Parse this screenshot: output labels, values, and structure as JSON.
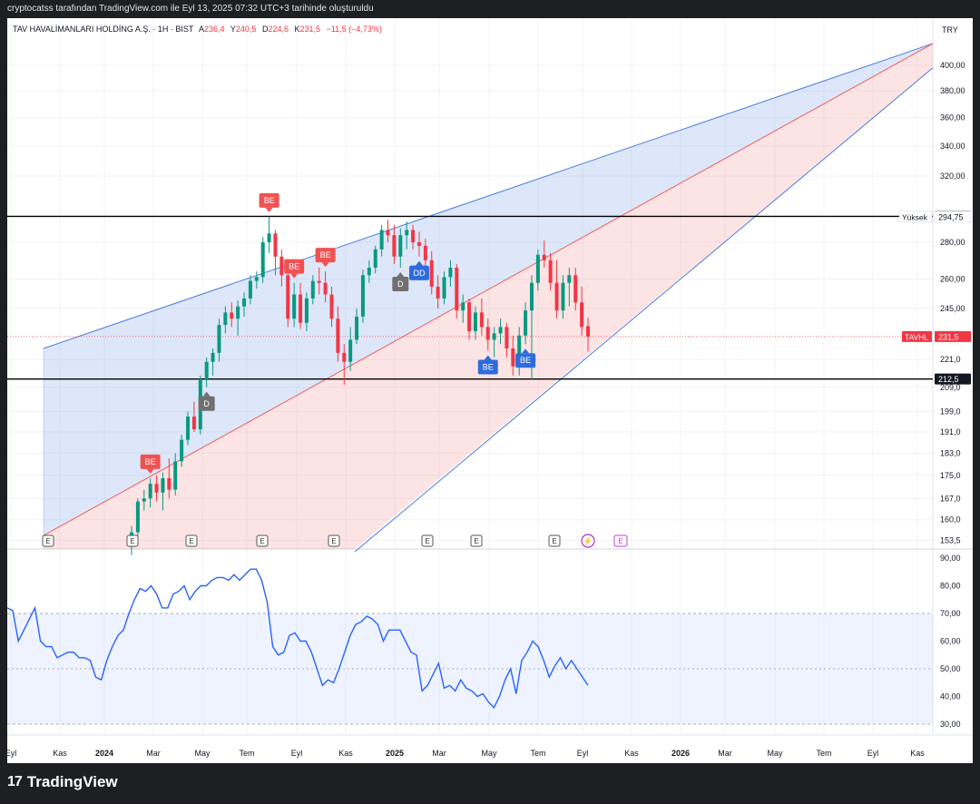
{
  "caption": "cryptocatss tarafından TradingView.com ile Eyl 13, 2025 07:32 UTC+3 tarihinde oluşturuldu",
  "brand": {
    "logo": "17",
    "name": "TradingView"
  },
  "header": {
    "symbol": "TAV HAVALİMANLARI HOLDİNG A.Ş. · 1H · BIST",
    "o_label": "A",
    "o_value": "236,4",
    "h_label": "Y",
    "h_value": "240,5",
    "l_label": "D",
    "l_value": "224,6",
    "c_label": "K",
    "c_value": "231,5",
    "change": "−11,5 (−4,73%)"
  },
  "currency": "TRY",
  "colors": {
    "up": "#089981",
    "down": "#f23645",
    "channel_blue": "#4a7bdc",
    "channel_red": "#f05a5a",
    "rsi": "#2962ff"
  },
  "chart_data": {
    "type": "candlestick",
    "yaxis": {
      "ticks": [
        "400,00",
        "380,00",
        "360,00",
        "340,00",
        "320,00",
        "295,00",
        "280,00",
        "260,00",
        "245,00",
        "221,0",
        "209,0",
        "199,0",
        "191,0",
        "183,0",
        "175,0",
        "167,0",
        "160,0",
        "153,5"
      ],
      "scale": "log"
    },
    "xaxis": {
      "ticks": [
        "Eyl",
        "Kas",
        "2024",
        "Mar",
        "May",
        "Tem",
        "Eyl",
        "Kas",
        "2025",
        "Mar",
        "May",
        "Tem",
        "Eyl",
        "Kas",
        "2026",
        "Mar",
        "May",
        "Tem",
        "Eyl",
        "Kas"
      ],
      "bold": [
        "2024",
        "2025",
        "2026"
      ]
    },
    "price_labels": [
      {
        "text": "295,00",
        "value": 295,
        "style": "black"
      },
      {
        "text": "Yüksek",
        "value2": "294,75",
        "value": 294.75,
        "style": "plain"
      },
      {
        "text": "TAVHL",
        "value2": "231,5",
        "value": 231.5,
        "style": "red"
      },
      {
        "text": "212,5",
        "value": 212.5,
        "style": "black"
      }
    ],
    "horizontal_lines": [
      295,
      212.5
    ],
    "candles": [
      {
        "o": 152,
        "h": 158,
        "l": 149,
        "c": 156
      },
      {
        "o": 156,
        "h": 167,
        "l": 154,
        "c": 166
      },
      {
        "o": 166,
        "h": 170,
        "l": 163,
        "c": 167
      },
      {
        "o": 167,
        "h": 174,
        "l": 164,
        "c": 172
      },
      {
        "o": 172,
        "h": 175,
        "l": 166,
        "c": 169
      },
      {
        "o": 169,
        "h": 176,
        "l": 163,
        "c": 174
      },
      {
        "o": 174,
        "h": 181,
        "l": 167,
        "c": 170
      },
      {
        "o": 170,
        "h": 183,
        "l": 168,
        "c": 180
      },
      {
        "o": 180,
        "h": 190,
        "l": 178,
        "c": 188
      },
      {
        "o": 188,
        "h": 199,
        "l": 186,
        "c": 197
      },
      {
        "o": 197,
        "h": 203,
        "l": 191,
        "c": 192
      },
      {
        "o": 192,
        "h": 214,
        "l": 190,
        "c": 212
      },
      {
        "o": 212,
        "h": 222,
        "l": 209,
        "c": 220
      },
      {
        "o": 220,
        "h": 226,
        "l": 214,
        "c": 224
      },
      {
        "o": 224,
        "h": 240,
        "l": 220,
        "c": 237
      },
      {
        "o": 237,
        "h": 246,
        "l": 233,
        "c": 243
      },
      {
        "o": 243,
        "h": 248,
        "l": 236,
        "c": 240
      },
      {
        "o": 240,
        "h": 249,
        "l": 232,
        "c": 246
      },
      {
        "o": 246,
        "h": 253,
        "l": 241,
        "c": 250
      },
      {
        "o": 250,
        "h": 262,
        "l": 247,
        "c": 259
      },
      {
        "o": 259,
        "h": 264,
        "l": 255,
        "c": 261
      },
      {
        "o": 261,
        "h": 283,
        "l": 258,
        "c": 280
      },
      {
        "o": 280,
        "h": 294.75,
        "l": 274,
        "c": 285
      },
      {
        "o": 285,
        "h": 287,
        "l": 262,
        "c": 272
      },
      {
        "o": 272,
        "h": 276,
        "l": 256,
        "c": 262
      },
      {
        "o": 262,
        "h": 266,
        "l": 236,
        "c": 240
      },
      {
        "o": 240,
        "h": 258,
        "l": 236,
        "c": 252
      },
      {
        "o": 252,
        "h": 258,
        "l": 235,
        "c": 238
      },
      {
        "o": 238,
        "h": 253,
        "l": 234,
        "c": 250
      },
      {
        "o": 250,
        "h": 262,
        "l": 247,
        "c": 259
      },
      {
        "o": 259,
        "h": 266,
        "l": 252,
        "c": 258
      },
      {
        "o": 258,
        "h": 264,
        "l": 248,
        "c": 252
      },
      {
        "o": 252,
        "h": 256,
        "l": 236,
        "c": 240
      },
      {
        "o": 240,
        "h": 246,
        "l": 220,
        "c": 224
      },
      {
        "o": 224,
        "h": 228,
        "l": 210,
        "c": 220
      },
      {
        "o": 220,
        "h": 236,
        "l": 216,
        "c": 230
      },
      {
        "o": 230,
        "h": 245,
        "l": 228,
        "c": 241
      },
      {
        "o": 241,
        "h": 265,
        "l": 238,
        "c": 262
      },
      {
        "o": 262,
        "h": 270,
        "l": 258,
        "c": 266
      },
      {
        "o": 266,
        "h": 278,
        "l": 263,
        "c": 276
      },
      {
        "o": 276,
        "h": 290,
        "l": 272,
        "c": 287
      },
      {
        "o": 287,
        "h": 293,
        "l": 280,
        "c": 284
      },
      {
        "o": 284,
        "h": 290,
        "l": 268,
        "c": 272
      },
      {
        "o": 272,
        "h": 288,
        "l": 266,
        "c": 284
      },
      {
        "o": 284,
        "h": 292,
        "l": 276,
        "c": 287
      },
      {
        "o": 287,
        "h": 290,
        "l": 276,
        "c": 280
      },
      {
        "o": 280,
        "h": 286,
        "l": 272,
        "c": 278
      },
      {
        "o": 278,
        "h": 282,
        "l": 266,
        "c": 270
      },
      {
        "o": 270,
        "h": 275,
        "l": 252,
        "c": 256
      },
      {
        "o": 256,
        "h": 262,
        "l": 245,
        "c": 250
      },
      {
        "o": 250,
        "h": 264,
        "l": 247,
        "c": 261
      },
      {
        "o": 261,
        "h": 270,
        "l": 256,
        "c": 266
      },
      {
        "o": 266,
        "h": 268,
        "l": 240,
        "c": 244
      },
      {
        "o": 244,
        "h": 252,
        "l": 238,
        "c": 248
      },
      {
        "o": 248,
        "h": 250,
        "l": 230,
        "c": 234
      },
      {
        "o": 234,
        "h": 246,
        "l": 230,
        "c": 243
      },
      {
        "o": 243,
        "h": 250,
        "l": 232,
        "c": 236
      },
      {
        "o": 236,
        "h": 240,
        "l": 225,
        "c": 230
      },
      {
        "o": 230,
        "h": 236,
        "l": 222,
        "c": 233
      },
      {
        "o": 233,
        "h": 240,
        "l": 228,
        "c": 236
      },
      {
        "o": 236,
        "h": 238,
        "l": 222,
        "c": 226
      },
      {
        "o": 226,
        "h": 232,
        "l": 214,
        "c": 218
      },
      {
        "o": 218,
        "h": 236,
        "l": 214,
        "c": 232
      },
      {
        "o": 232,
        "h": 248,
        "l": 228,
        "c": 244
      },
      {
        "o": 244,
        "h": 262,
        "l": 212.5,
        "c": 258
      },
      {
        "o": 258,
        "h": 276,
        "l": 254,
        "c": 273
      },
      {
        "o": 273,
        "h": 281,
        "l": 266,
        "c": 270
      },
      {
        "o": 270,
        "h": 274,
        "l": 254,
        "c": 258
      },
      {
        "o": 258,
        "h": 270,
        "l": 240,
        "c": 244
      },
      {
        "o": 244,
        "h": 262,
        "l": 240,
        "c": 258
      },
      {
        "o": 258,
        "h": 266,
        "l": 246,
        "c": 262
      },
      {
        "o": 262,
        "h": 266,
        "l": 244,
        "c": 248
      },
      {
        "o": 248,
        "h": 256,
        "l": 232,
        "c": 236
      },
      {
        "o": 236.4,
        "h": 240.5,
        "l": 224.6,
        "c": 231.5
      }
    ],
    "channel": {
      "upper_blue": [
        [
          0,
          226
        ],
        [
          1,
          418
        ]
      ],
      "middle_red": [
        [
          0,
          155
        ],
        [
          1,
          418
        ]
      ],
      "lower_blue": [
        [
          0.35,
          150
        ],
        [
          1,
          398
        ]
      ]
    },
    "markers": [
      {
        "label": "BE",
        "kind": "red-down",
        "bar": 3
      },
      {
        "label": "D",
        "kind": "gray-up",
        "bar": 12
      },
      {
        "label": "BE",
        "kind": "red-down",
        "bar": 22
      },
      {
        "label": "BE",
        "kind": "red-down",
        "bar": 26
      },
      {
        "label": "BE",
        "kind": "red-down",
        "bar": 31
      },
      {
        "label": "D",
        "kind": "gray-up",
        "bar": 43
      },
      {
        "label": "D",
        "kind": "gray-up",
        "bar": 46
      },
      {
        "label": "DD",
        "kind": "blue-up",
        "bar": 46
      },
      {
        "label": "BE",
        "kind": "blue-up",
        "bar": 57
      },
      {
        "label": "BE",
        "kind": "blue-up",
        "bar": 63
      }
    ],
    "earnings_markers": [
      "E",
      "E",
      "E",
      "E",
      "E",
      "E",
      "E",
      "E",
      "E"
    ],
    "rsi": {
      "yticks": [
        "90,00",
        "80,00",
        "70,00",
        "60,00",
        "50,00",
        "40,00",
        "30,00"
      ],
      "band": [
        30,
        70
      ],
      "mid": 50,
      "values": [
        72,
        71,
        60,
        64,
        68,
        72,
        60,
        58,
        58,
        54,
        55,
        56,
        56,
        54,
        54,
        53,
        47,
        46,
        53,
        58,
        62,
        64,
        70,
        75,
        79,
        78,
        80,
        77,
        72,
        72,
        77,
        78,
        80,
        75,
        78,
        80,
        80,
        82,
        83,
        83,
        82,
        84,
        82,
        84,
        86,
        86,
        82,
        74,
        58,
        55,
        56,
        62,
        63,
        60,
        60,
        56,
        50,
        44,
        46,
        45,
        50,
        56,
        62,
        66,
        67,
        69,
        68,
        66,
        60,
        64,
        64,
        64,
        60,
        56,
        55,
        42,
        44,
        48,
        52,
        43,
        44,
        42,
        46,
        43,
        42,
        40,
        41,
        38,
        36,
        40,
        46,
        50,
        41,
        53,
        56,
        60,
        58,
        53,
        47,
        51,
        54,
        50,
        53,
        50,
        47,
        44
      ]
    }
  }
}
